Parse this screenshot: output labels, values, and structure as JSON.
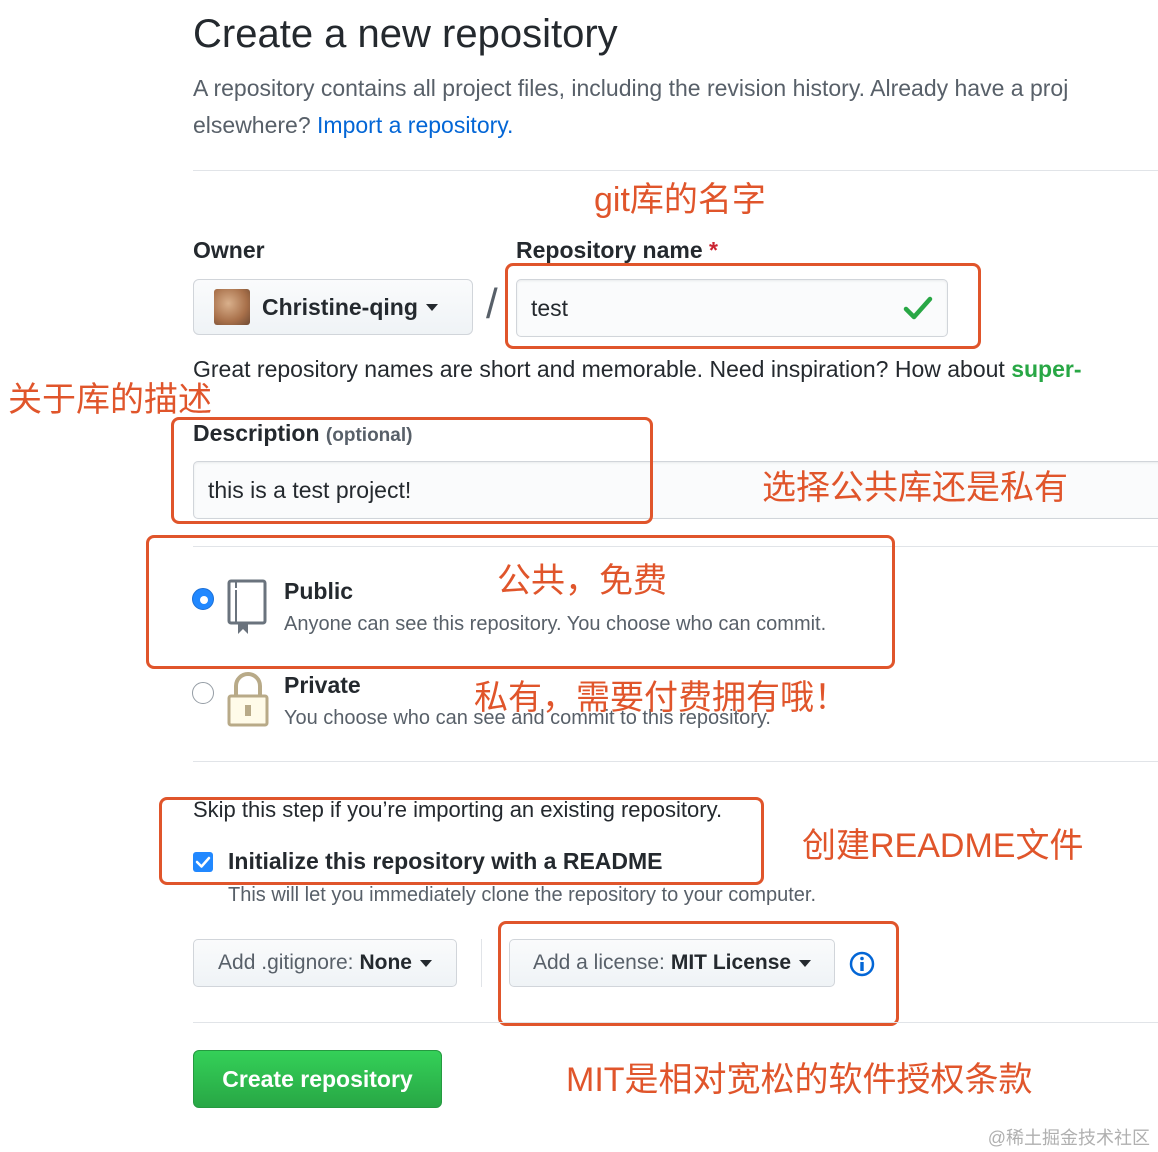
{
  "header": {
    "title": "Create a new repository",
    "subtitle_line1": "A repository contains all project files, including the revision history. Already have a proj",
    "subtitle_line2_prefix": "elsewhere? ",
    "import_link": "Import a repository."
  },
  "owner": {
    "label": "Owner",
    "value": "Christine-qing"
  },
  "repo_name": {
    "label": "Repository name",
    "required_mark": "*",
    "value": "test"
  },
  "slash": "/",
  "name_hint": {
    "text": "Great repository names are short and memorable. Need inspiration? How about ",
    "suggestion": "super-"
  },
  "description": {
    "label": "Description",
    "optional": "(optional)",
    "value": "this is a test project!"
  },
  "visibility": {
    "public": {
      "title": "Public",
      "desc": "Anyone can see this repository. You choose who can commit.",
      "selected": true
    },
    "private": {
      "title": "Private",
      "desc": "You choose who can see and commit to this repository.",
      "selected": false
    }
  },
  "init": {
    "skip_text": "Skip this step if you’re importing an existing repository.",
    "readme_label": "Initialize this repository with a README",
    "readme_checked": true,
    "readme_desc": "This will let you immediately clone the repository to your computer."
  },
  "gitignore": {
    "prefix": "Add .gitignore:",
    "value": "None"
  },
  "license": {
    "prefix": "Add a license:",
    "value": "MIT License"
  },
  "create_button": "Create repository",
  "annotations": {
    "repo_name": "git库的名字",
    "description": "关于库的描述",
    "visibility": "选择公共库还是私有",
    "public": "公共，免费",
    "private": "私有，需要付费拥有哦！",
    "readme": "创建README文件",
    "license": "MIT是相对宽松的软件授权条款"
  },
  "watermark": "@稀土掘金技术社区",
  "colors": {
    "annotation": "#e0552b",
    "link": "#0366d6",
    "primary_button": "#28a745",
    "radio_checkbox": "#2188ff"
  },
  "icons": {
    "check": "check-icon",
    "repo": "repo-book-icon",
    "lock": "lock-icon",
    "info": "info-icon",
    "caret": "caret-down-icon"
  }
}
